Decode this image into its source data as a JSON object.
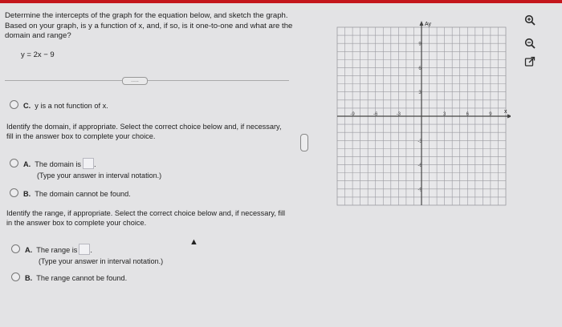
{
  "question": {
    "text": "Determine the intercepts of the graph for the equation below, and sketch the graph. Based on your graph, is y a function of x, and, if so, is it one-to-one and what are the domain and range?",
    "equation": "y = 2x − 9",
    "expand_label": "....."
  },
  "choice_c": {
    "letter": "C.",
    "text": "y is a not function of x."
  },
  "domain": {
    "instruction": "Identify the domain, if appropriate. Select the correct choice below and, if necessary, fill in the answer box to complete your choice.",
    "option_a": {
      "letter": "A.",
      "text": "The domain is",
      "hint": "(Type your answer in interval notation.)"
    },
    "option_b": {
      "letter": "B.",
      "text": "The domain cannot be found."
    }
  },
  "range": {
    "instruction": "Identify the range, if appropriate. Select the correct choice below and, if necessary, fill in the answer box to complete your choice.",
    "option_a": {
      "letter": "A.",
      "text": "The range is",
      "hint": "(Type your answer in interval notation.)"
    },
    "option_b": {
      "letter": "B.",
      "text": "The range cannot be found."
    }
  },
  "graph": {
    "y_axis_label": "Ay",
    "x_axis_label": "x",
    "y_ticks": [
      "9",
      "6",
      "3",
      "-3",
      "-6",
      "-9"
    ],
    "x_ticks": [
      "-9",
      "-6",
      "-3",
      "3",
      "6",
      "9"
    ],
    "grid_color": "#9a9aa0",
    "axis_color": "#444444"
  },
  "toolbar": {
    "zoom_in_icon": "magnifier-plus-icon",
    "zoom_out_icon": "magnifier-minus-icon",
    "popout_icon": "external-link-icon"
  }
}
